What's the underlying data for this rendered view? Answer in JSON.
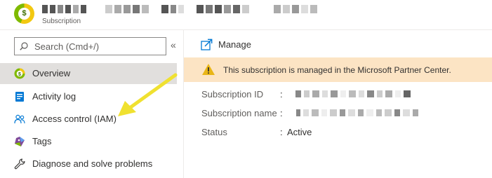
{
  "header": {
    "subtitle": "Subscription",
    "title_redacted": true,
    "subscription_icon_symbol": "$"
  },
  "sidebar": {
    "search": {
      "placeholder": "Search (Cmd+/)",
      "value": ""
    },
    "collapse_label": "«",
    "items": [
      {
        "label": "Overview",
        "icon": "subscription-overview-icon",
        "active": true
      },
      {
        "label": "Activity log",
        "icon": "activity-log-icon",
        "active": false
      },
      {
        "label": "Access control (IAM)",
        "icon": "access-control-icon",
        "active": false
      },
      {
        "label": "Tags",
        "icon": "tag-icon",
        "active": false
      },
      {
        "label": "Diagnose and solve problems",
        "icon": "wrench-icon",
        "active": false
      }
    ]
  },
  "main": {
    "manage_label": "Manage",
    "banner": {
      "text": "This subscription is managed in the Microsoft Partner Center.",
      "icon": "warning-icon"
    },
    "properties": [
      {
        "label": "Subscription ID",
        "value": "",
        "redacted": true
      },
      {
        "label": "Subscription name",
        "value": "",
        "redacted": true
      },
      {
        "label": "Status",
        "value": "Active",
        "redacted": false
      }
    ],
    "separator": ":"
  },
  "annotation": {
    "color": "#f0e130",
    "points_to": "Access control (IAM)"
  },
  "colors": {
    "active_nav_bg": "#e1dfdd",
    "banner_bg": "#fce4c4",
    "accent_blue": "#0078d4",
    "warning": "#d8a800"
  }
}
